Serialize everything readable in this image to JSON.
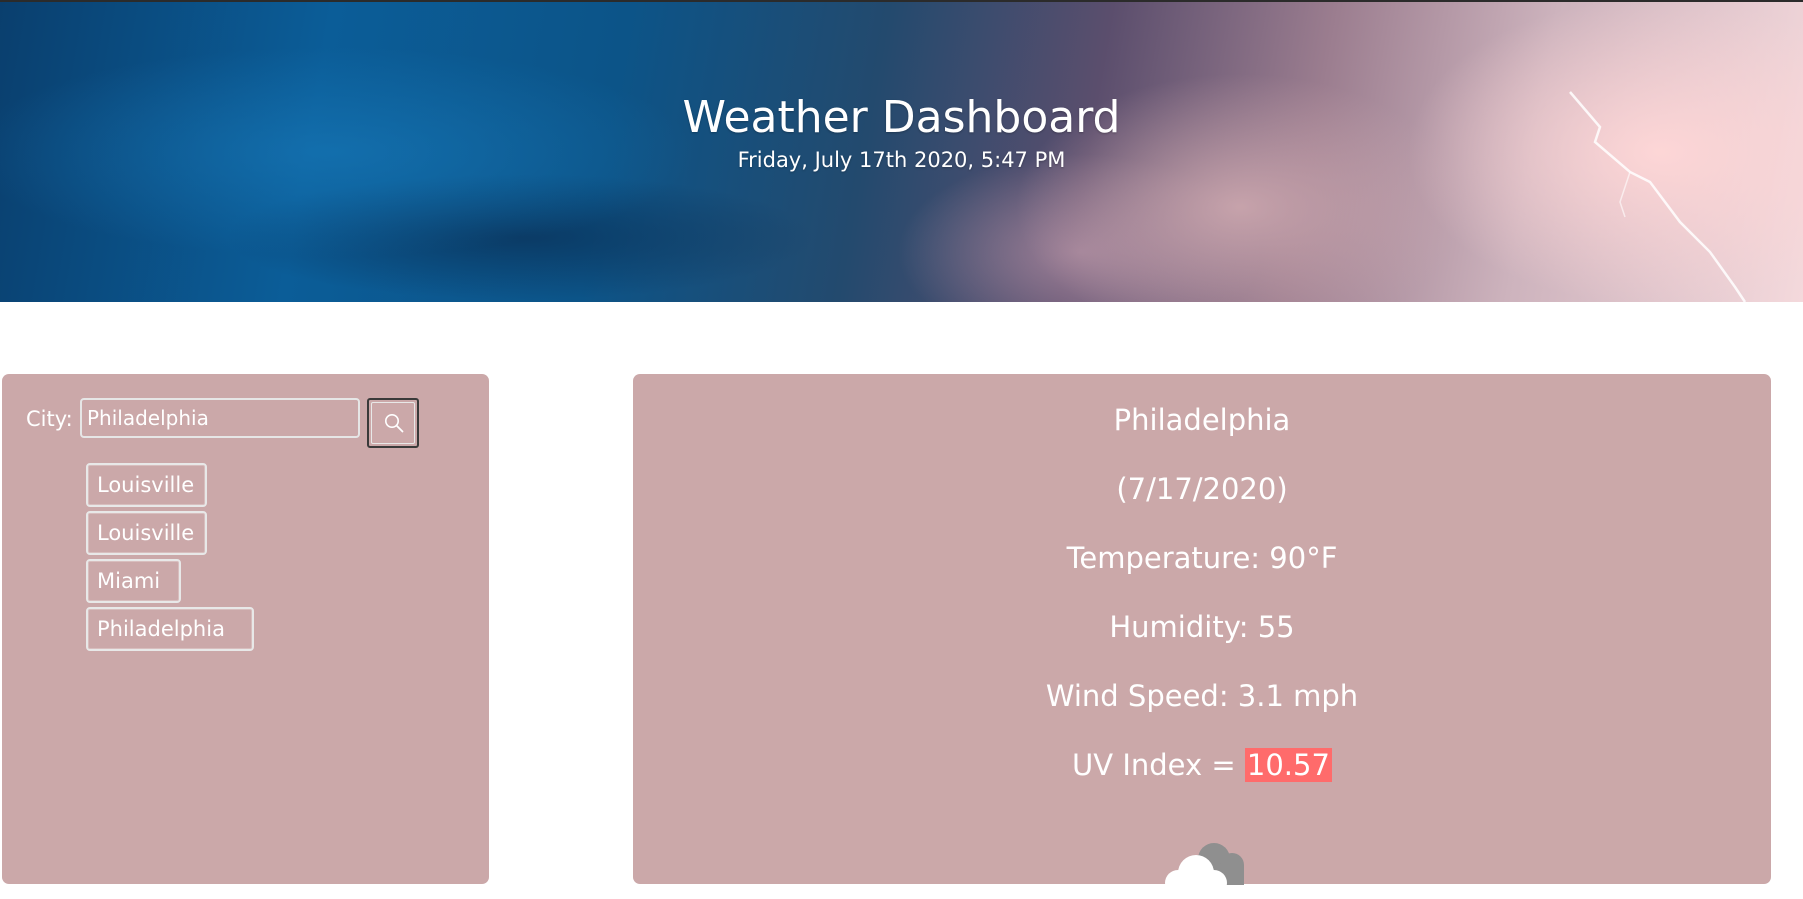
{
  "header": {
    "title": "Weather Dashboard",
    "datetime": "Friday, July 17th 2020, 5:47 PM"
  },
  "search": {
    "label": "City:",
    "value": "Philadelphia",
    "button_icon": "search-icon"
  },
  "history": {
    "items": [
      {
        "label": "Louisville"
      },
      {
        "label": "Louisville"
      },
      {
        "label": "Miami"
      },
      {
        "label": "Philadelphia"
      }
    ]
  },
  "current": {
    "city": "Philadelphia",
    "date": "(7/17/2020)",
    "temperature": "Temperature: 90°F",
    "humidity": "Humidity: 55",
    "wind": "Wind Speed: 3.1 mph",
    "uv_label": "UV Index = ",
    "uv_value": "10.57",
    "icon": "cloud-icon"
  },
  "colors": {
    "panel": "#cba8a9",
    "uv_high": "#ff6b6b",
    "text": "#ffffff"
  }
}
